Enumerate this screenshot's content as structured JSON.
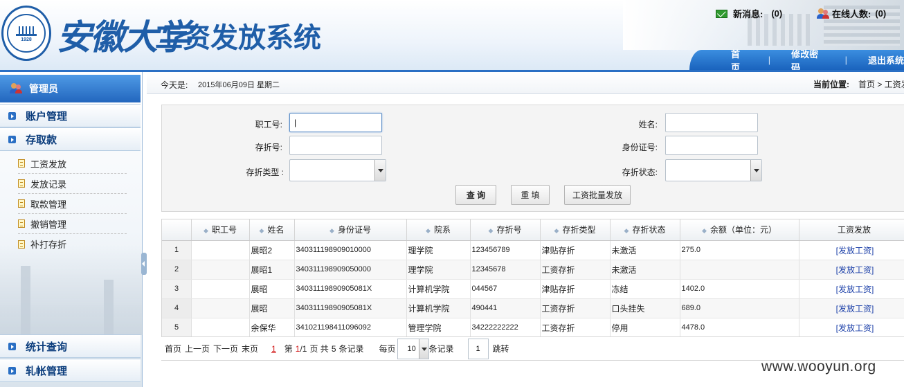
{
  "header": {
    "brand_name": "安徽大学",
    "system_name": "工资发放系统",
    "seal_year": "1928",
    "messages_label": "新消息:",
    "messages_count": "(0)",
    "online_label": "在线人数:",
    "online_count": "(0)",
    "nav": [
      "首页",
      "修改密码",
      "退出系统"
    ]
  },
  "sidebar": {
    "admin_label": "管理员",
    "sections": [
      {
        "label": "账户管理"
      },
      {
        "label": "存取款",
        "items": [
          "工资发放",
          "发放记录",
          "取款管理",
          "撤销管理",
          "补打存折"
        ]
      },
      {
        "label": "统计查询"
      },
      {
        "label": "轧帐管理"
      }
    ]
  },
  "infobar": {
    "today_label": "今天是:",
    "today_value": "2015年06月09日 星期二",
    "location_label": "当前位置:",
    "location_value": "首页 > 工资发放"
  },
  "search": {
    "fields": {
      "staff_no": {
        "label": "职工号:",
        "value": "|"
      },
      "name": {
        "label": "姓名:",
        "value": ""
      },
      "passbook_no": {
        "label": "存折号:",
        "value": ""
      },
      "id_no": {
        "label": "身份证号:",
        "value": ""
      },
      "passbook_type": {
        "label": "存折类型 :",
        "value": ""
      },
      "passbook_status": {
        "label": "存折状态:",
        "value": ""
      }
    },
    "buttons": {
      "query": "查 询",
      "reset": "重 填",
      "batch": "工资批量发放"
    }
  },
  "table": {
    "columns": [
      "职工号",
      "姓名",
      "身份证号",
      "院系",
      "存折号",
      "存折类型",
      "存折状态",
      "余额（单位：元）",
      "工资发放"
    ],
    "rows": [
      {
        "idx": "1",
        "staff": "",
        "name": "展昭2",
        "id": "340311198909010000",
        "dept": "理学院",
        "passbook": "123456789",
        "type": "津贴存折",
        "status": "未激活",
        "balance": "275.0",
        "action": "[发放工资]"
      },
      {
        "idx": "2",
        "staff": "",
        "name": "展昭1",
        "id": "340311198909050000",
        "dept": "理学院",
        "passbook": "12345678",
        "type": "工资存折",
        "status": "未激活",
        "balance": "",
        "action": "[发放工资]"
      },
      {
        "idx": "3",
        "staff": "",
        "name": "展昭",
        "id": "34031119890905081X",
        "dept": "计算机学院",
        "passbook": "044567",
        "type": "津贴存折",
        "status": "冻结",
        "balance": "1402.0",
        "action": "[发放工资]"
      },
      {
        "idx": "4",
        "staff": "",
        "name": "展昭",
        "id": "34031119890905081X",
        "dept": "计算机学院",
        "passbook": "490441",
        "type": "工资存折",
        "status": "口头挂失",
        "balance": "689.0",
        "action": "[发放工资]"
      },
      {
        "idx": "5",
        "staff": "",
        "name": "余保华",
        "id": "341021198411096092",
        "dept": "管理学院",
        "passbook": "34222222222",
        "type": "工资存折",
        "status": "停用",
        "balance": "4478.0",
        "action": "[发放工资]"
      }
    ]
  },
  "pager": {
    "first": "首页",
    "prev": "上一页",
    "next": "下一页",
    "last": "末页",
    "current": "1",
    "page_prefix": "第",
    "page_current": "1",
    "page_total": "/1",
    "page_suffix": "页 共",
    "record_count": "5",
    "record_suffix": "条记录",
    "per_page_label": "每页",
    "per_page_value": "10",
    "per_page_suffix": "条记录",
    "goto_value": "1",
    "goto_label": "跳转"
  },
  "watermark": "www.wooyun.org"
}
